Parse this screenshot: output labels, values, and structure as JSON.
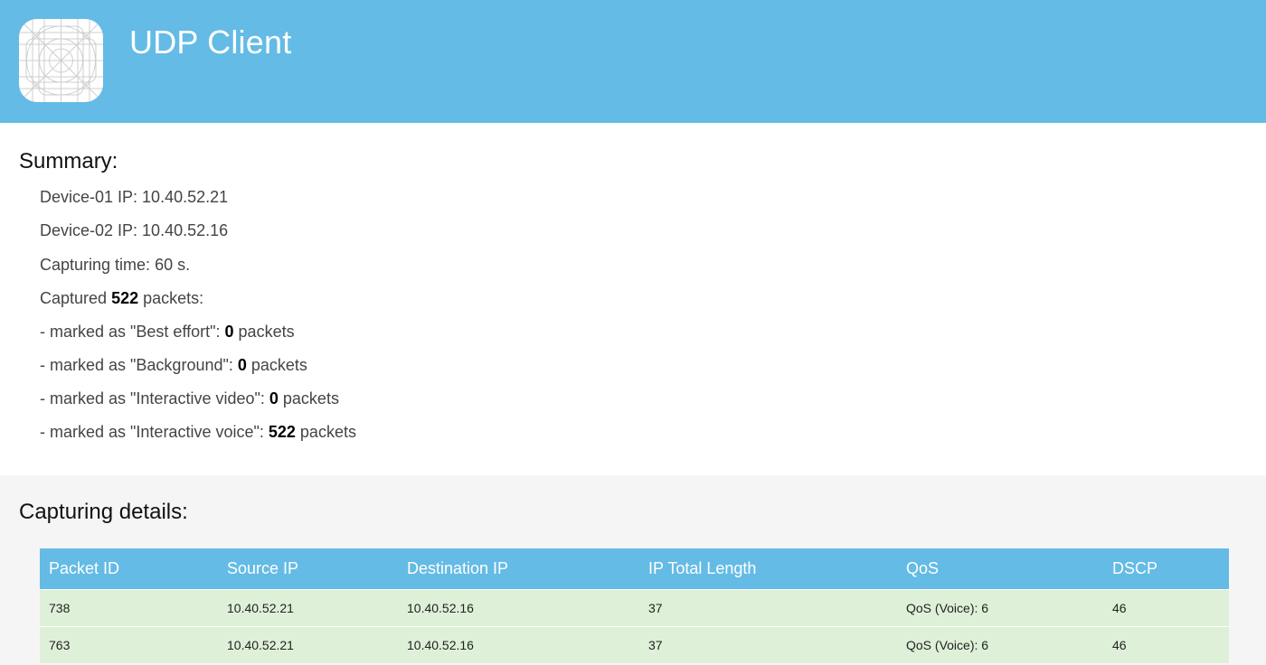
{
  "header": {
    "app_icon": "app-placeholder-icon",
    "title": "UDP Client",
    "background_color": "#64bbe5"
  },
  "summary": {
    "title": "Summary:",
    "device1_label": "Device-01 IP: ",
    "device1_ip": "10.40.52.21",
    "device2_label": "Device-02 IP: ",
    "device2_ip": "10.40.52.16",
    "capturing_time_label": "Capturing time: ",
    "capturing_time_value": "60 s.",
    "captured_prefix": "Captured ",
    "captured_count": "522",
    "captured_suffix": " packets:",
    "categories": [
      {
        "prefix": "- marked as \"Best effort\": ",
        "count": "0",
        "suffix": " packets"
      },
      {
        "prefix": "- marked as \"Background\": ",
        "count": "0",
        "suffix": " packets"
      },
      {
        "prefix": "- marked as \"Interactive video\": ",
        "count": "0",
        "suffix": " packets"
      },
      {
        "prefix": "- marked as \"Interactive voice\": ",
        "count": "522",
        "suffix": " packets"
      }
    ]
  },
  "details": {
    "title": "Capturing details:",
    "columns": [
      "Packet ID",
      "Source IP",
      "Destination IP",
      "IP Total Length",
      "QoS",
      "DSCP"
    ],
    "rows": [
      [
        "738",
        "10.40.52.21",
        "10.40.52.16",
        "37",
        "QoS (Voice): 6",
        "46"
      ],
      [
        "763",
        "10.40.52.21",
        "10.40.52.16",
        "37",
        "QoS (Voice): 6",
        "46"
      ]
    ],
    "row_color": "#dff0d8"
  }
}
